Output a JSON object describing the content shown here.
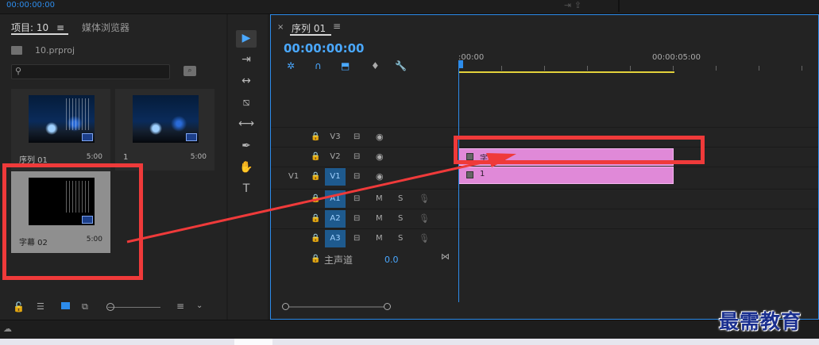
{
  "top": {
    "timecode": "00:00:00:00",
    "right_icons": "⇥  ⇪"
  },
  "project_panel": {
    "tab_project": "项目: 10",
    "tab_menu": "≡",
    "tab_media": "媒体浏览器",
    "project_file": "10.prproj",
    "search_placeholder": "",
    "items": [
      {
        "name": "序列 01",
        "duration": "5:00"
      },
      {
        "name": "1",
        "duration": "5:00"
      },
      {
        "name": "字幕 02",
        "duration": "5:00"
      }
    ],
    "bottom_icons": {
      "lock": "🔓",
      "list": "☰",
      "freeform": "⧉",
      "sort": "≡",
      "chevron": "⌄"
    }
  },
  "tools": [
    "▶",
    "⇥",
    "↔",
    "⧅",
    "⟷",
    "✒",
    "✋",
    "T"
  ],
  "timeline": {
    "tab_close": "×",
    "tab_title": "序列 01",
    "tab_menu": "≡",
    "timecode": "00:00:00:00",
    "toolbar_icons": [
      "✲",
      "∩",
      "⬒",
      "♦",
      "🔧"
    ],
    "ruler": {
      "start": ":00:00",
      "mark": "00:00:05:00"
    },
    "video_tracks": [
      {
        "name": "V3",
        "source": ""
      },
      {
        "name": "V2",
        "source": ""
      },
      {
        "name": "V1",
        "source": "V1"
      }
    ],
    "audio_tracks": [
      {
        "name": "A1",
        "m": "M",
        "s": "S"
      },
      {
        "name": "A2",
        "m": "M",
        "s": "S"
      },
      {
        "name": "A3",
        "m": "M",
        "s": "S"
      }
    ],
    "clips": [
      {
        "track": "V2",
        "label": "字幕 02"
      },
      {
        "track": "V1",
        "label": "1"
      }
    ],
    "master": {
      "label": "主声道",
      "value": "0.0"
    }
  },
  "watermark": "最需教育",
  "colors": {
    "accent_blue": "#2d8ceb",
    "clip_pink": "#e089d8",
    "work_area_yellow": "#e3d23b",
    "annotation_red": "#ef3a3a"
  }
}
